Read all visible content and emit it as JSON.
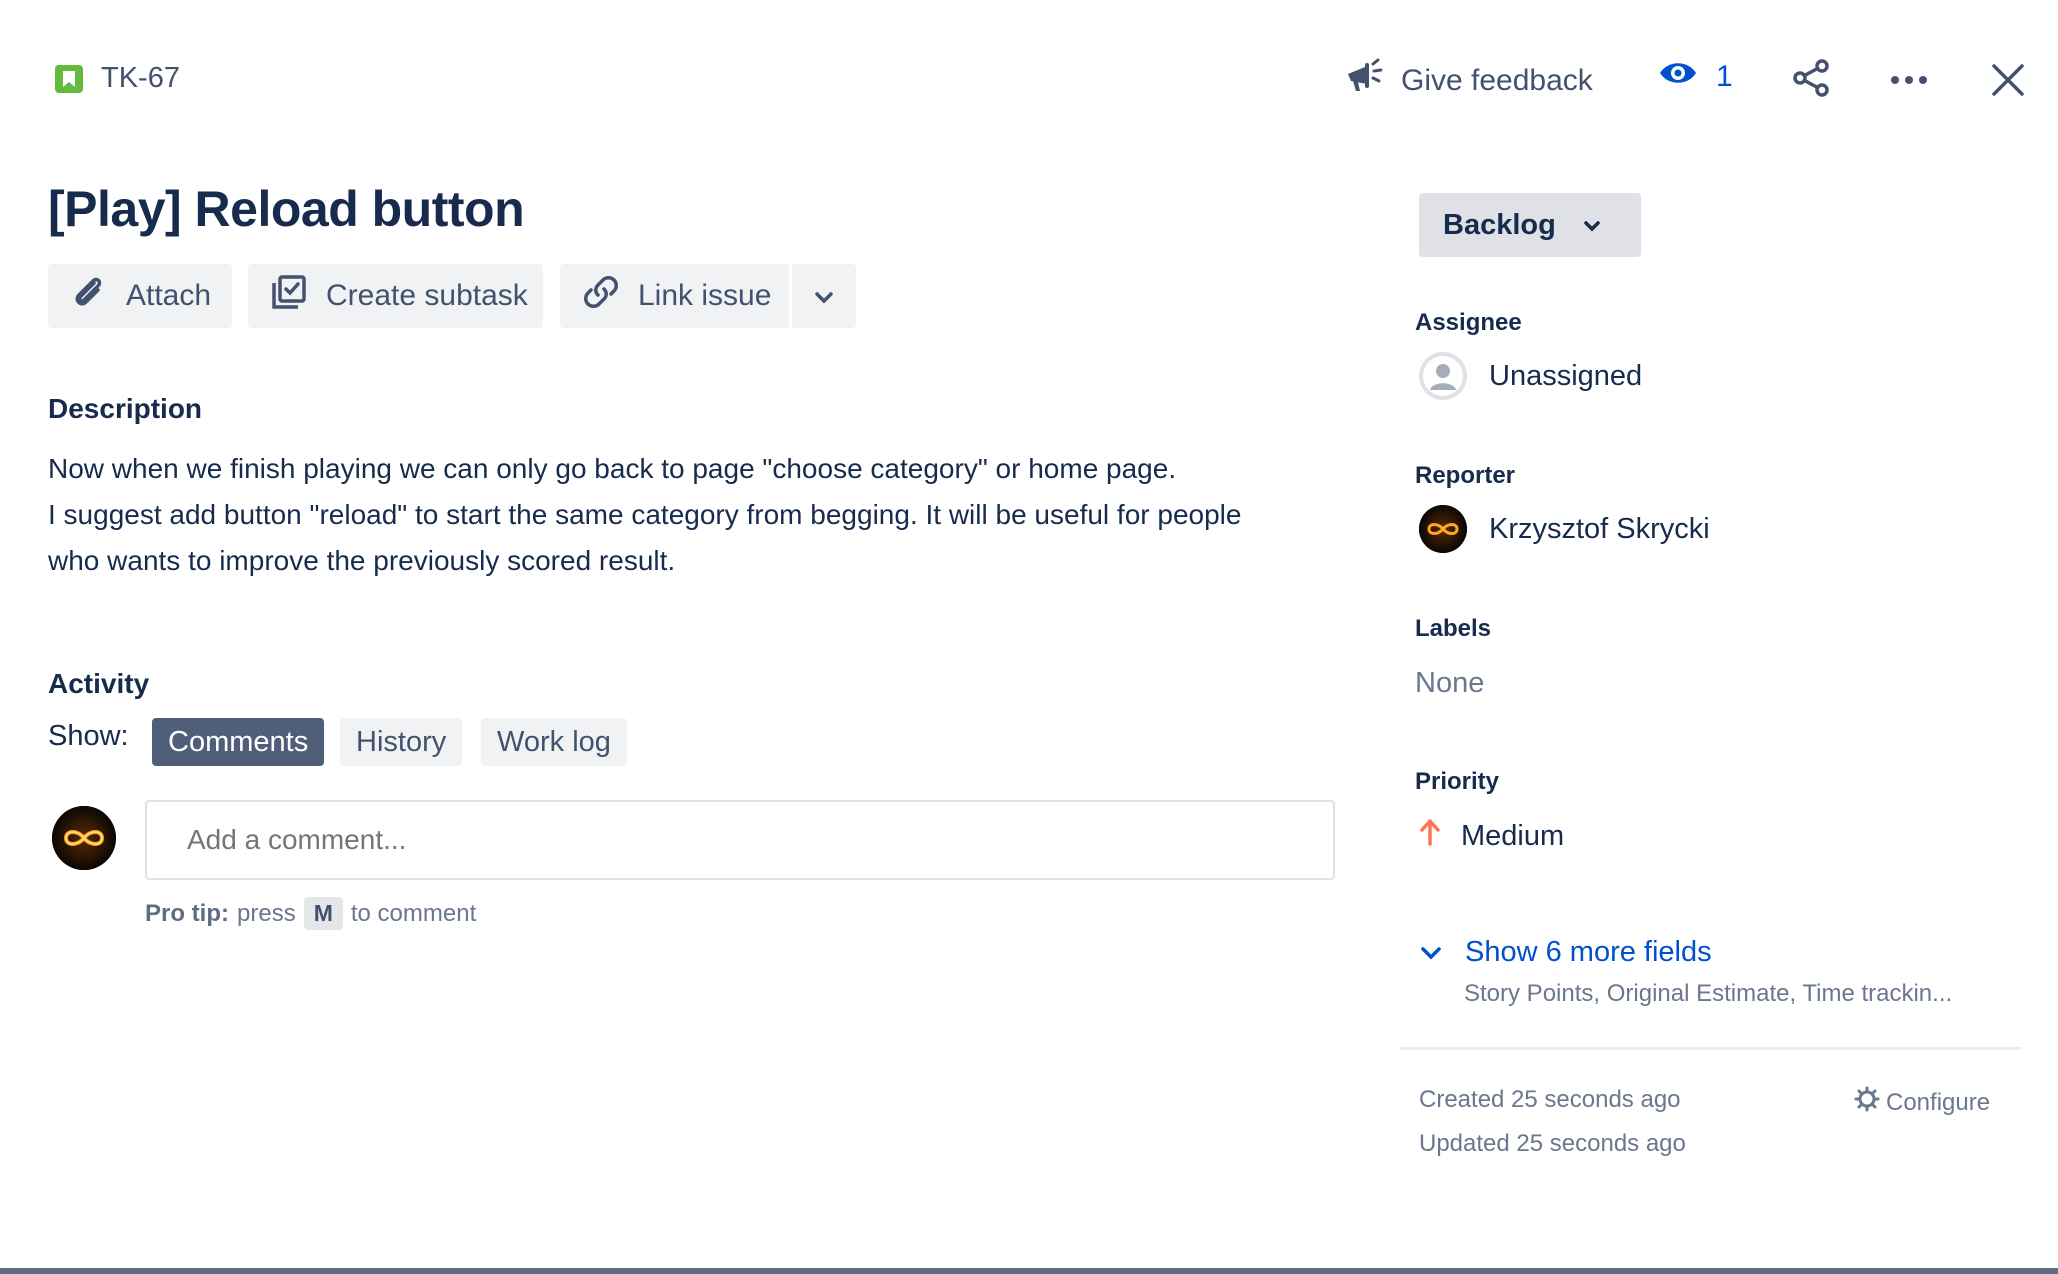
{
  "header": {
    "issue_key": "TK-67",
    "feedback_label": "Give feedback",
    "watchers_count": "1"
  },
  "issue": {
    "title": "[Play] Reload button"
  },
  "actions": {
    "attach": "Attach",
    "create_subtask": "Create subtask",
    "link_issue": "Link issue"
  },
  "description": {
    "heading": "Description",
    "lines": [
      "Now when we finish playing we can only go back to page \"choose category\" or home page.",
      "I suggest add button \"reload\" to start the same category from begging. It will be useful for people",
      "who wants to improve the previously scored result."
    ]
  },
  "activity": {
    "heading": "Activity",
    "show_label": "Show:",
    "tabs": [
      "Comments",
      "History",
      "Work log"
    ],
    "active_tab": "Comments",
    "comment_placeholder": "Add a comment...",
    "protip_label": "Pro tip:",
    "protip_press": "press",
    "protip_key": "M",
    "protip_suffix": "to comment"
  },
  "sidebar": {
    "status": "Backlog",
    "assignee_label": "Assignee",
    "assignee_value": "Unassigned",
    "reporter_label": "Reporter",
    "reporter_value": "Krzysztof Skrycki",
    "labels_label": "Labels",
    "labels_value": "None",
    "priority_label": "Priority",
    "priority_value": "Medium",
    "more_fields_label": "Show 6 more fields",
    "more_fields_sub": "Story Points, Original Estimate, Time trackin...",
    "created": "Created 25 seconds ago",
    "updated": "Updated 25 seconds ago",
    "configure": "Configure"
  },
  "colors": {
    "story_green": "#63BA3C",
    "link_blue": "#0052CC",
    "priority_orange": "#FF7452",
    "active_tab_bg": "#505F79"
  }
}
